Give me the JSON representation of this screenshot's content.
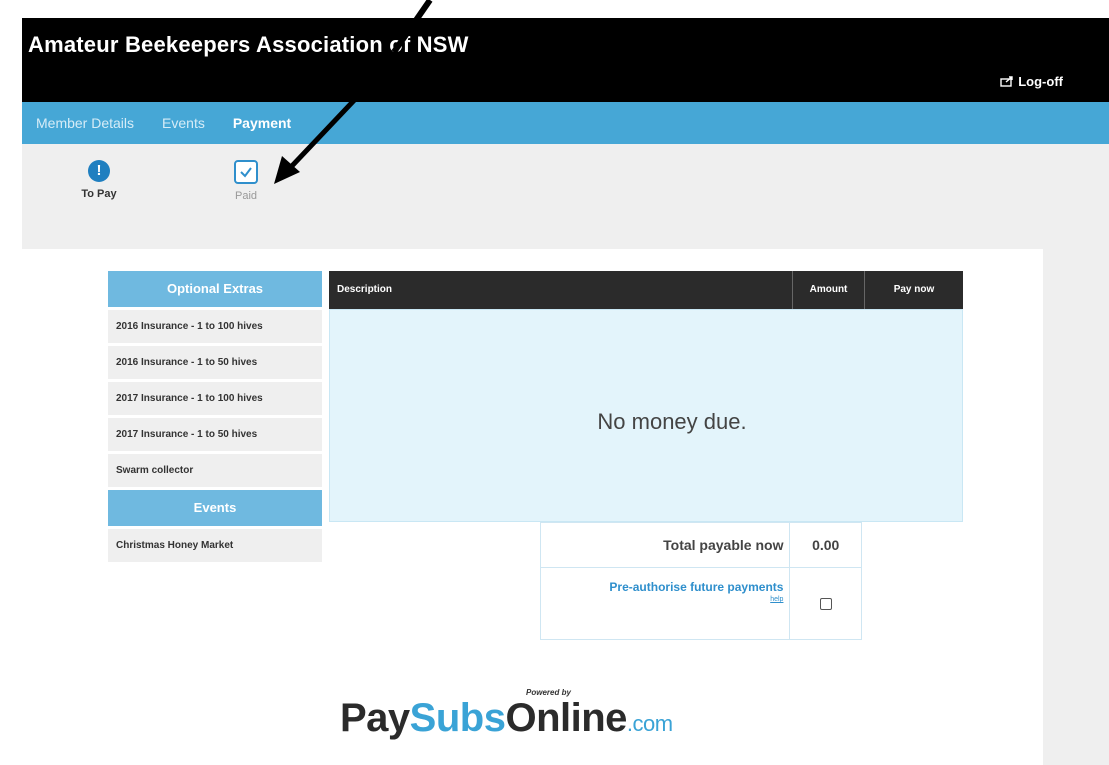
{
  "header": {
    "title": "Amateur Beekeepers Association of NSW",
    "logoff_label": "Log-off"
  },
  "nav": {
    "items": [
      {
        "label": "Member Details"
      },
      {
        "label": "Events"
      },
      {
        "label": "Payment"
      }
    ]
  },
  "status_tabs": {
    "to_pay": {
      "label": "To Pay",
      "icon": "exclamation-icon"
    },
    "paid": {
      "label": "Paid",
      "icon": "checkbox-icon"
    }
  },
  "sidebar": {
    "optional_extras_heading": "Optional Extras",
    "optional_extras": [
      {
        "label": "2016 Insurance - 1 to 100 hives"
      },
      {
        "label": "2016 Insurance - 1 to 50 hives"
      },
      {
        "label": "2017 Insurance - 1 to 100 hives"
      },
      {
        "label": "2017 Insurance - 1 to 50 hives"
      },
      {
        "label": "Swarm collector"
      }
    ],
    "events_heading": "Events",
    "events": [
      {
        "label": "Christmas Honey Market"
      }
    ]
  },
  "table": {
    "headers": {
      "description": "Description",
      "amount": "Amount",
      "pay_now": "Pay now"
    },
    "empty_message": "No money due."
  },
  "totals": {
    "total_label": "Total payable now",
    "total_value": "0.00",
    "preauth_label": "Pre-authorise future payments",
    "help_label": "help"
  },
  "footer": {
    "powered_by": "Powered by",
    "brand_pay": "Pay",
    "brand_subs": "Subs",
    "brand_online": "Online",
    "brand_com": ".com"
  },
  "colors": {
    "header_bg": "#000000",
    "nav_bg": "#46a7d6",
    "sidebar_heading": "#6fb9e0",
    "table_header": "#2b2b2b",
    "table_body": "#e3f4fb",
    "brand_blue": "#3aa3d6"
  }
}
